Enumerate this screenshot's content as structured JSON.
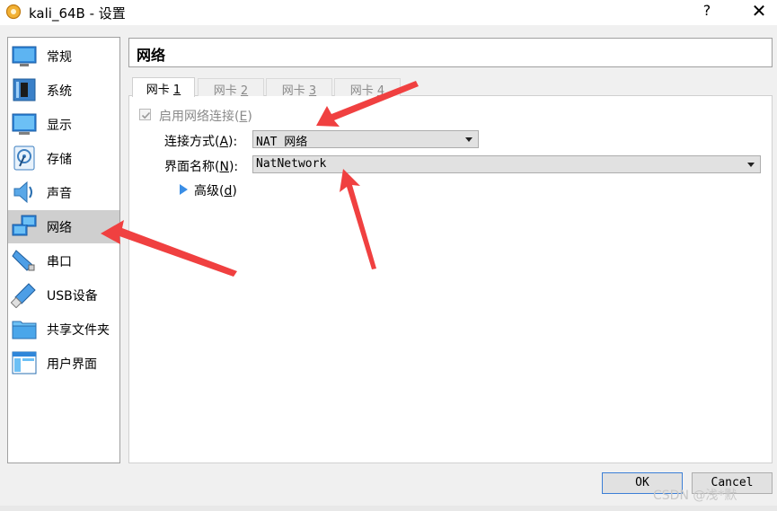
{
  "window": {
    "title": "kali_64B - 设置",
    "help_label": "?",
    "close_label": "✕"
  },
  "sidebar": {
    "items": [
      {
        "label": "常规",
        "icon": "general-icon"
      },
      {
        "label": "系统",
        "icon": "system-icon"
      },
      {
        "label": "显示",
        "icon": "display-icon"
      },
      {
        "label": "存储",
        "icon": "storage-icon"
      },
      {
        "label": "声音",
        "icon": "audio-icon"
      },
      {
        "label": "网络",
        "icon": "network-icon",
        "selected": true
      },
      {
        "label": "串口",
        "icon": "serial-port-icon"
      },
      {
        "label": "USB设备",
        "icon": "usb-icon"
      },
      {
        "label": "共享文件夹",
        "icon": "shared-folder-icon"
      },
      {
        "label": "用户界面",
        "icon": "user-interface-icon"
      }
    ]
  },
  "page": {
    "title": "网络"
  },
  "tabs": [
    {
      "text": "网卡 ",
      "mnemonic": "1",
      "active": true
    },
    {
      "text": "网卡 ",
      "mnemonic": "2",
      "active": false
    },
    {
      "text": "网卡 ",
      "mnemonic": "3",
      "active": false
    },
    {
      "text": "网卡 ",
      "mnemonic": "4",
      "active": false
    }
  ],
  "form": {
    "enable_network": {
      "label_prefix": "启用网络连接(",
      "mnemonic": "E",
      "label_suffix": ")",
      "checked": true
    },
    "attached_to": {
      "label_prefix": "连接方式(",
      "mnemonic": "A",
      "label_suffix": "):",
      "value": "NAT 网络"
    },
    "name": {
      "label_prefix": "界面名称(",
      "mnemonic": "N",
      "label_suffix": "):",
      "value": "NatNetwork"
    },
    "advanced": {
      "label_prefix": "高级(",
      "mnemonic": "d",
      "label_suffix": ")"
    }
  },
  "buttons": {
    "ok": "OK",
    "cancel": "Cancel"
  },
  "watermark": "CSDN @浅*默",
  "colors": {
    "annotation_arrow": "#f04040",
    "selected_item": "#cfcfcf",
    "ok_border": "#3c7fd6"
  }
}
